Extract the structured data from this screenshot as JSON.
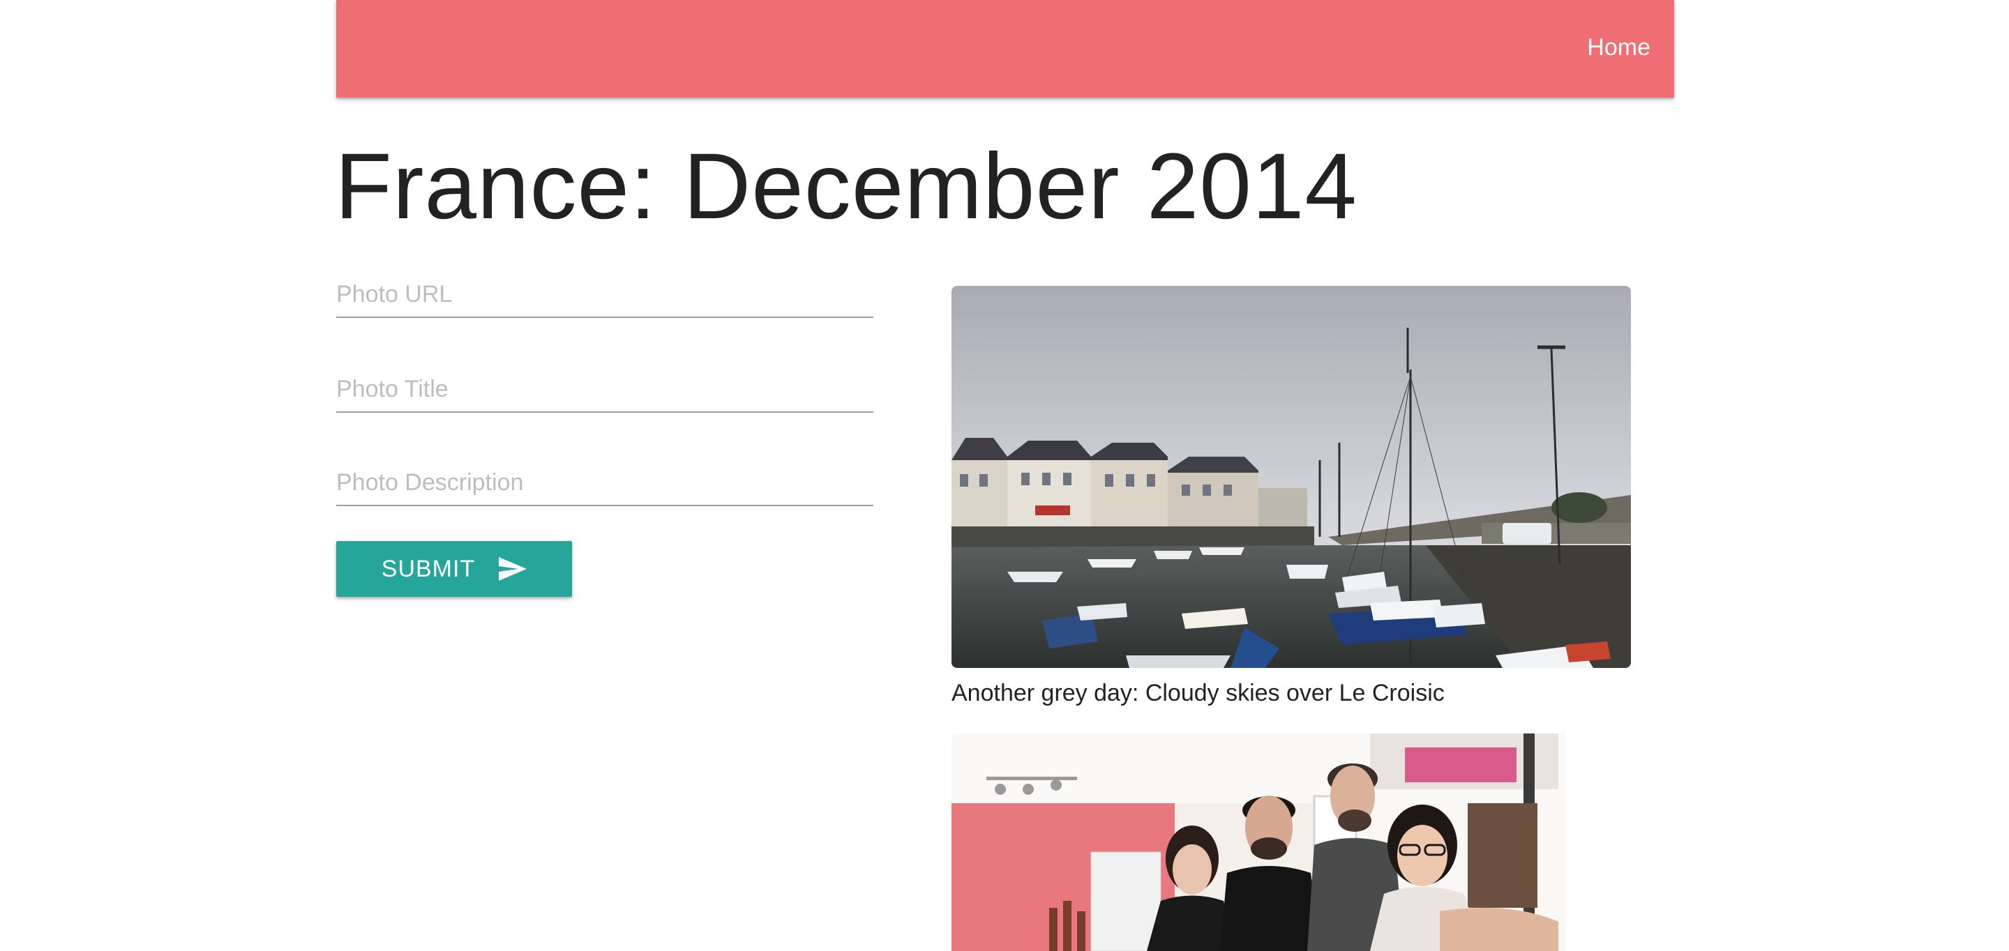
{
  "navbar": {
    "color": "#ee6e73",
    "home_label": "Home"
  },
  "page": {
    "title": "France: December 2014"
  },
  "form": {
    "url_placeholder": "Photo URL",
    "title_placeholder": "Photo Title",
    "description_placeholder": "Photo Description",
    "submit_label": "SUBMIT",
    "submit_icon": "send-icon",
    "submit_color": "#26a69a"
  },
  "photos": [
    {
      "caption": "Another grey day: Cloudy skies over Le Croisic",
      "scene": "harbor"
    },
    {
      "caption": "",
      "scene": "group-portrait"
    }
  ]
}
